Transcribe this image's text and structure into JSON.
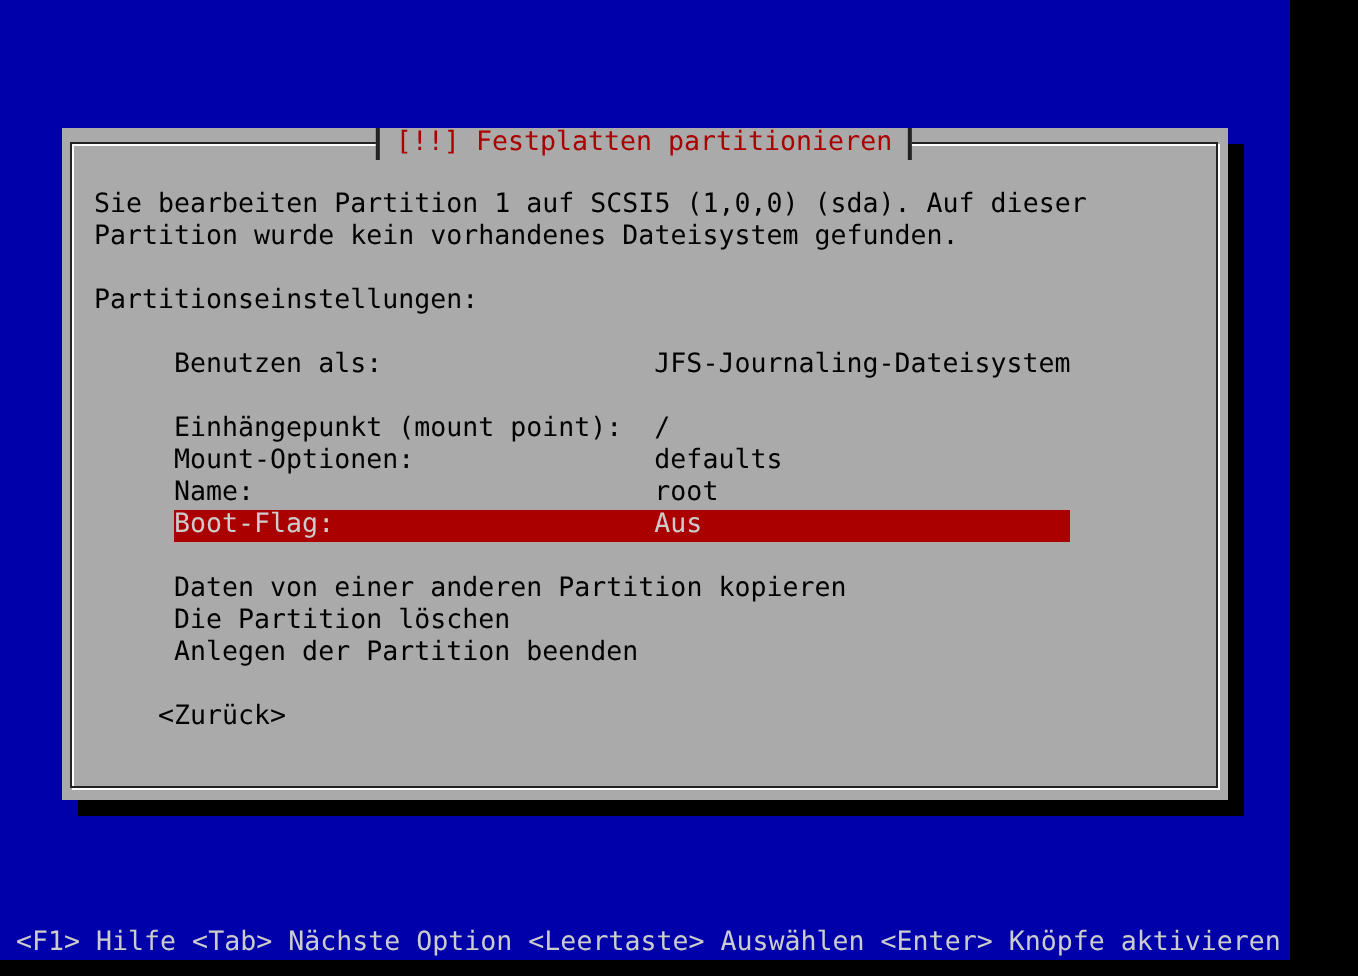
{
  "window": {
    "title": "[!!] Festplatten partitionieren"
  },
  "description": "Sie bearbeiten Partition 1 auf SCSI5 (1,0,0) (sda). Auf dieser Partition wurde kein vorhandenes Dateisystem gefunden.",
  "section_label": "Partitionseinstellungen:",
  "setting_groups": [
    {
      "items": [
        {
          "label": "Benutzen als:",
          "value": "JFS-Journaling-Dateisystem",
          "selected": false
        }
      ]
    },
    {
      "items": [
        {
          "label": "Einhängepunkt (mount point):",
          "value": "/",
          "selected": false
        },
        {
          "label": "Mount-Optionen:",
          "value": "defaults",
          "selected": false
        },
        {
          "label": "Name:",
          "value": "root",
          "selected": false
        },
        {
          "label": "Boot-Flag:",
          "value": "Aus",
          "selected": true
        }
      ]
    }
  ],
  "actions": [
    {
      "label": "Daten von einer anderen Partition kopieren",
      "selected": false
    },
    {
      "label": "Die Partition löschen",
      "selected": false
    },
    {
      "label": "Anlegen der Partition beenden",
      "selected": false
    }
  ],
  "back_button": {
    "label": "<Zurück>"
  },
  "status_bar": "<F1> Hilfe <Tab> Nächste Option <Leertaste> Auswählen <Enter> Knöpfe aktivieren"
}
